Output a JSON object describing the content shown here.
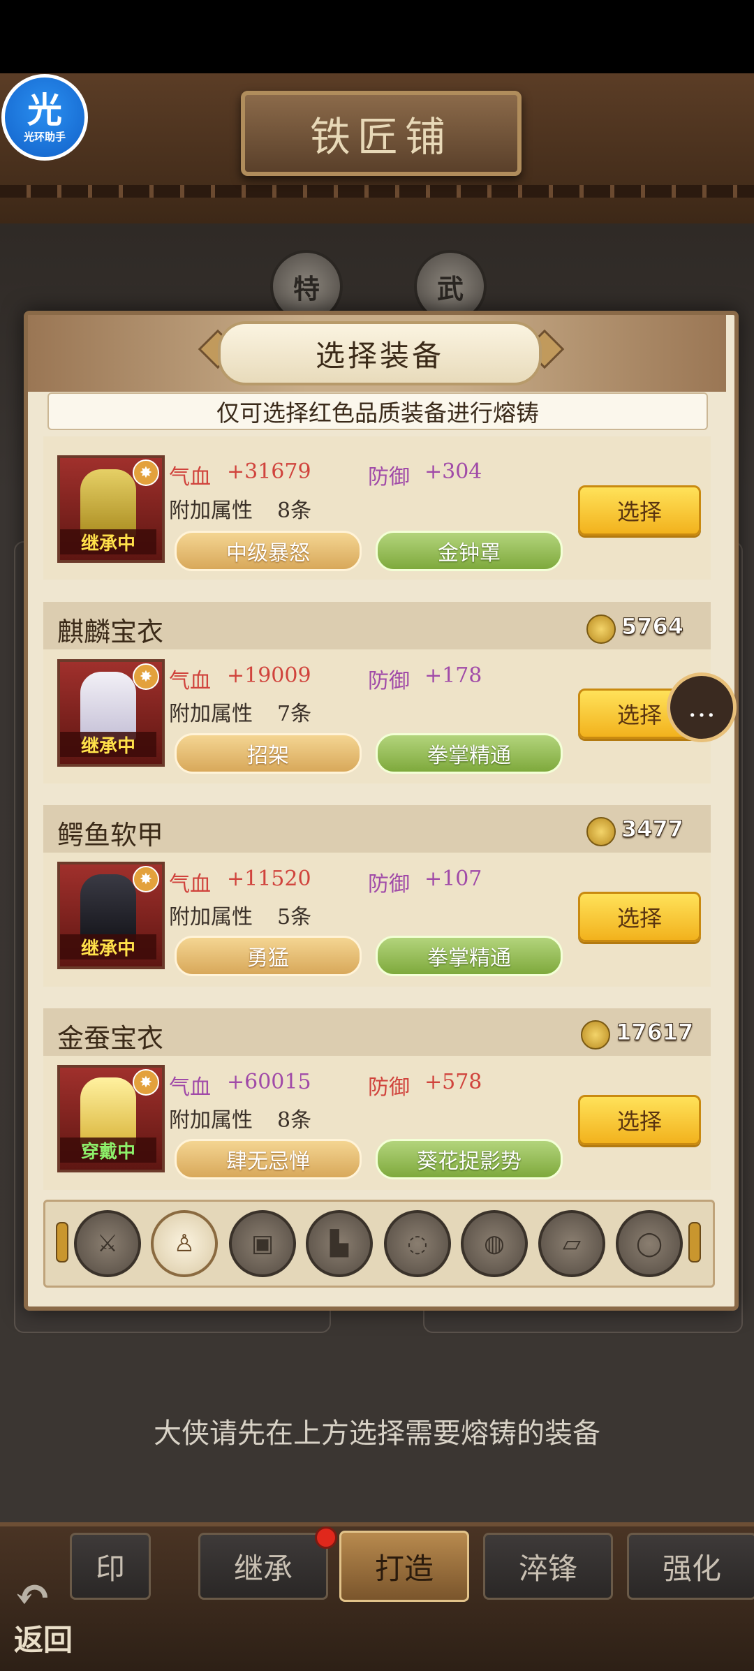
{
  "assistant": {
    "glyph": "光",
    "label": "光环助手"
  },
  "shop_title": "铁匠铺",
  "medals": [
    "特",
    "武"
  ],
  "modal": {
    "title": "选择装备",
    "notice": "仅可选择红色品质装备进行熔铸"
  },
  "labels": {
    "hp": "气血",
    "def": "防御",
    "extra": "附加属性",
    "select": "选择"
  },
  "items": [
    {
      "name": "",
      "price": "",
      "hp": "+31679",
      "def": "+304",
      "extra_count": "8条",
      "tag": "继承中",
      "skill1": "中级暴怒",
      "skill2": "金钟罩"
    },
    {
      "name": "麒麟宝衣",
      "price": "5764",
      "hp": "+19009",
      "def": "+178",
      "extra_count": "7条",
      "tag": "继承中",
      "skill1": "招架",
      "skill2": "拳掌精通"
    },
    {
      "name": "鳄鱼软甲",
      "price": "3477",
      "hp": "+11520",
      "def": "+107",
      "extra_count": "5条",
      "tag": "继承中",
      "skill1": "勇猛",
      "skill2": "拳掌精通"
    },
    {
      "name": "金蚕宝衣",
      "price": "17617",
      "hp": "+60015",
      "def": "+578",
      "extra_count": "8条",
      "tag": "穿戴中",
      "skill1": "肆无忌惮",
      "skill2": "葵花捉影势"
    }
  ],
  "slots": [
    "weapon-slot",
    "armor-slot",
    "helmet-slot",
    "boots-slot",
    "necklace-slot",
    "waist-slot",
    "amulet-slot",
    "ring-slot"
  ],
  "hint": "大侠请先在上方选择需要熔铸的装备",
  "tabs": [
    "印",
    "继承",
    "打造",
    "淬锋",
    "强化"
  ],
  "back_label": "返回",
  "colors": {
    "hp": "#d0433c",
    "def": "#a04aa8",
    "select_button": "#f2b21d"
  }
}
